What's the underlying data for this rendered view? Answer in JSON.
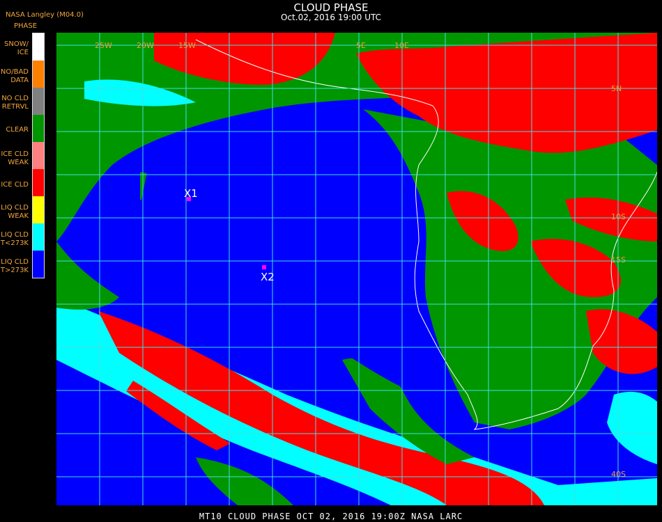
{
  "header": {
    "credit": "NASA Langley (M04.0)",
    "title": "CLOUD PHASE",
    "subtitle": "Oct.02, 2016 19:00 UTC"
  },
  "legend": {
    "header": "PHASE",
    "items": [
      {
        "label": "SNOW/\nICE",
        "color": "#ffffff"
      },
      {
        "label": "NO/BAD\nDATA",
        "color": "#ff8000"
      },
      {
        "label": "NO CLD\nRETRVL",
        "color": "#808080"
      },
      {
        "label": "CLEAR",
        "color": "#009600"
      },
      {
        "label": "ICE CLD\nWEAK",
        "color": "#ff8080"
      },
      {
        "label": "ICE CLD",
        "color": "#ff0000"
      },
      {
        "label": "LIQ CLD\nWEAK",
        "color": "#ffff00"
      },
      {
        "label": "LIQ CLD\nT<273K",
        "color": "#00ffff"
      },
      {
        "label": "LIQ CLD\nT>273K",
        "color": "#0000ff"
      }
    ]
  },
  "map": {
    "grid_color": "#40e0e0",
    "coast_color": "#ffffff",
    "markers": [
      {
        "label": "X1",
        "color": "#ff00ff"
      },
      {
        "label": "X2",
        "color": "#ff00ff"
      }
    ],
    "grid_labels": {
      "top": [
        "25W",
        "20W",
        "15W",
        "5E",
        "10E"
      ],
      "right": [
        "5N",
        "10S",
        "15S",
        "40S"
      ]
    }
  },
  "footer": "MT10  CLOUD PHASE   OCT 02, 2016 19:00Z   NASA LARC"
}
